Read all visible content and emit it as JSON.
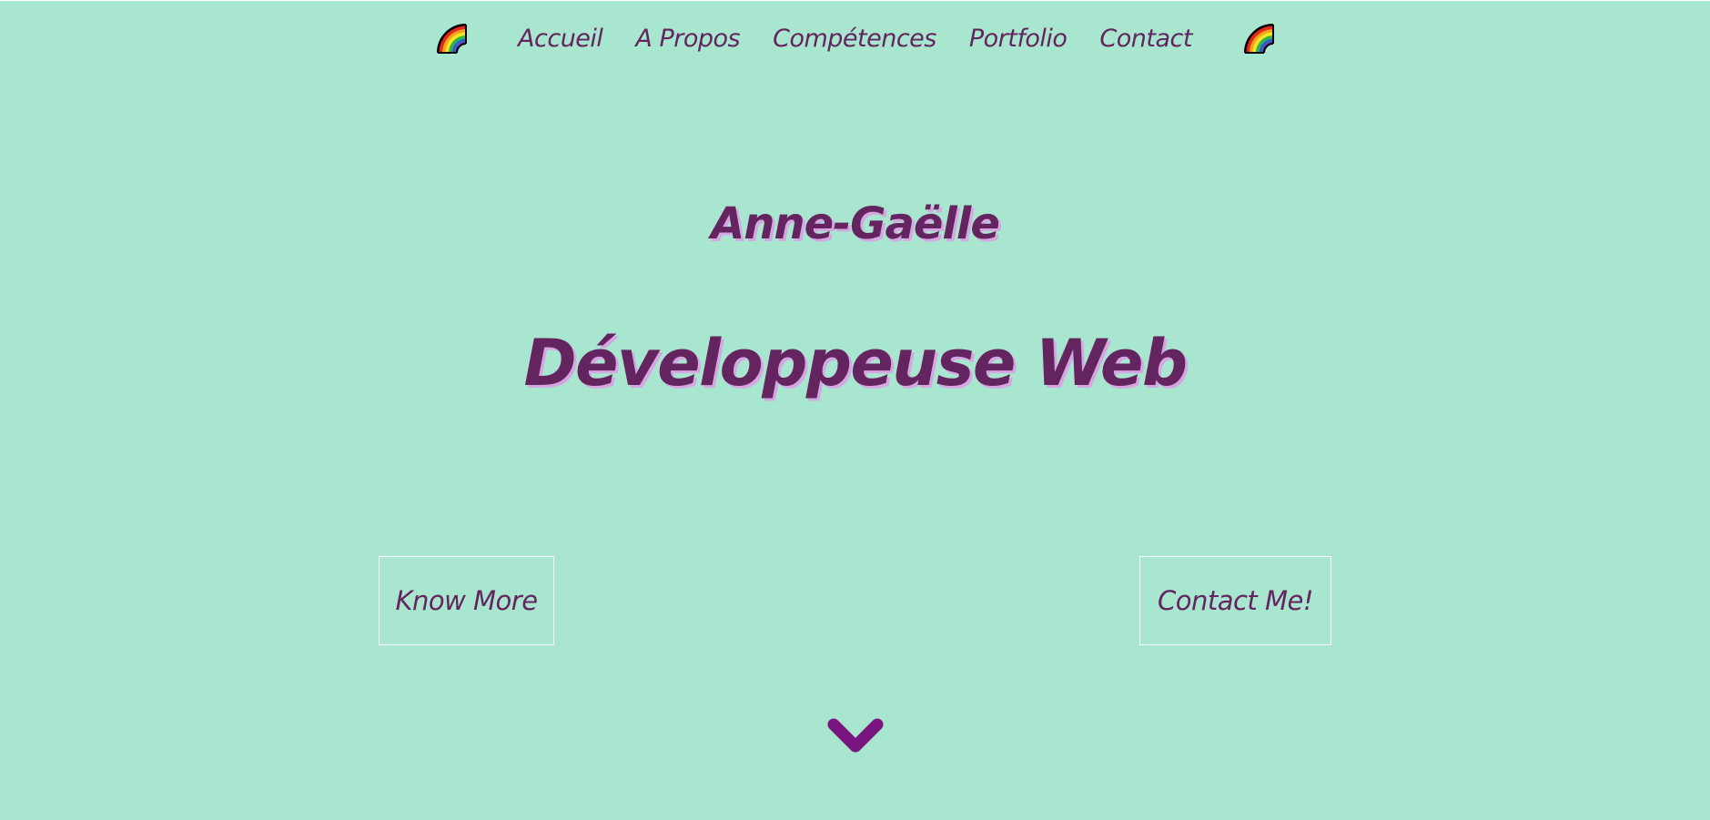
{
  "nav": {
    "left_icon": "rainbow-icon",
    "right_icon": "rainbow-icon",
    "links": [
      {
        "label": "Accueil"
      },
      {
        "label": "A Propos"
      },
      {
        "label": "Compétences"
      },
      {
        "label": "Portfolio"
      },
      {
        "label": "Contact"
      }
    ]
  },
  "hero": {
    "name": "Anne-Gaëlle",
    "title": "Développeuse Web"
  },
  "buttons": {
    "know_more": "Know More",
    "contact_me": "Contact Me!"
  },
  "scroll_icon": "chevron-down-icon",
  "colors": {
    "background": "#a8e6cf",
    "text": "#63245f",
    "text_shadow": "#d6a6e3",
    "chevron": "#7a1480",
    "button_border": "#ffffff"
  }
}
